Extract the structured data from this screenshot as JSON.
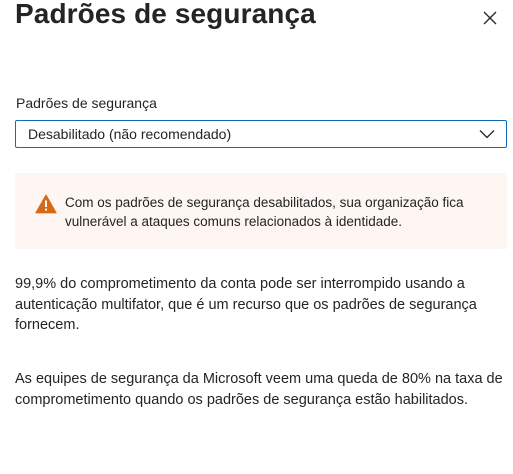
{
  "panel": {
    "title": "Padrões de segurança",
    "close_icon": "close-icon"
  },
  "security_defaults": {
    "label": "Padrões de segurança",
    "selected_value": "Desabilitado (não recomendado)",
    "chevron_icon": "chevron-down-icon"
  },
  "warning": {
    "icon": "warning-icon",
    "icon_color": "#d46a17",
    "background_color": "#fdf6f3",
    "text": "Com os padrões de segurança desabilitados, sua organização fica vulnerável a ataques comuns relacionados à identidade."
  },
  "info": {
    "paragraph_1": "99,9% do comprometimento da conta pode ser interrompido usando a autenticação multifator, que é um recurso que os padrões de segurança fornecem.",
    "paragraph_2": "As equipes de segurança da Microsoft veem uma queda de 80% na taxa de comprometimento quando os padrões de segurança estão habilitados."
  },
  "colors": {
    "accent": "#0f6cbd",
    "text": "#242424"
  }
}
